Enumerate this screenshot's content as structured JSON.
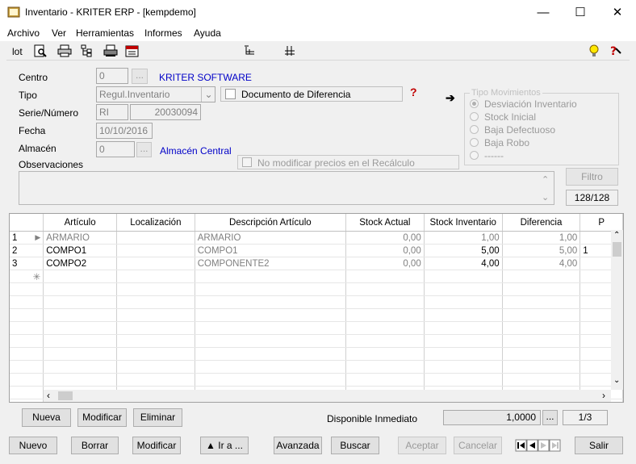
{
  "window": {
    "title": "Inventario - KRITER ERP - [kempdemo]",
    "min": "—",
    "max": "☐",
    "close": "✕"
  },
  "menu": [
    "Archivo",
    "Ver",
    "Herramientas",
    "Informes",
    "Ayuda"
  ],
  "toolbar": {
    "lot_label": "lot"
  },
  "form": {
    "centro_label": "Centro",
    "centro_value": "0",
    "centro_name": "KRITER SOFTWARE",
    "tipo_label": "Tipo",
    "tipo_value": "Regul.Inventario",
    "doc_diferencia": "Documento de Diferencia",
    "serie_label": "Serie/Número",
    "serie_value": "RI",
    "numero_value": "20030094",
    "fecha_label": "Fecha",
    "fecha_value": "10/10/2016",
    "almacen_label": "Almacén",
    "almacen_value": "0",
    "almacen_name": "Almacén Central",
    "observaciones_label": "Observaciones",
    "no_modificar": "No modificar precios en el Recálculo",
    "ellipsis": "..."
  },
  "tipo_movimientos": {
    "title": "Tipo Movimientos",
    "options": [
      "Desviación Inventario",
      "Stock Inicial",
      "Baja Defectuoso",
      "Baja Robo",
      "------"
    ]
  },
  "filtro": {
    "label": "Filtro",
    "counter": "128/128"
  },
  "grid": {
    "columns": [
      "Artículo",
      "Localización",
      "Descripción Artículo",
      "Stock Actual",
      "Stock Inventario",
      "Diferencia",
      "P"
    ],
    "rows": [
      {
        "n": "1",
        "articulo": "ARMARIO",
        "loc": "",
        "desc": "ARMARIO",
        "actual": "0,00",
        "inventario": "1,00",
        "diferencia": "1,00",
        "p": ""
      },
      {
        "n": "2",
        "articulo": "COMPO1",
        "loc": "",
        "desc": "COMPO1",
        "actual": "0,00",
        "inventario": "5,00",
        "diferencia": "5,00",
        "p": "1"
      },
      {
        "n": "3",
        "articulo": "COMPO2",
        "loc": "",
        "desc": "COMPONENTE2",
        "actual": "0,00",
        "inventario": "4,00",
        "diferencia": "4,00",
        "p": ""
      }
    ]
  },
  "line_buttons": {
    "nueva": "Nueva",
    "modificar": "Modificar",
    "eliminar": "Eliminar"
  },
  "disponible": {
    "label": "Disponible Inmediato",
    "value": "1,0000",
    "page": "1/3"
  },
  "bottom_buttons": {
    "nuevo": "Nuevo",
    "borrar": "Borrar",
    "modificar": "Modificar",
    "ir_a": "▲ Ir a ...",
    "avanzada": "Avanzada",
    "buscar": "Buscar",
    "aceptar": "Aceptar",
    "cancelar": "Cancelar",
    "salir": "Salir"
  },
  "colors": {
    "link_blue": "#0000c8",
    "help_red": "#c00000"
  }
}
